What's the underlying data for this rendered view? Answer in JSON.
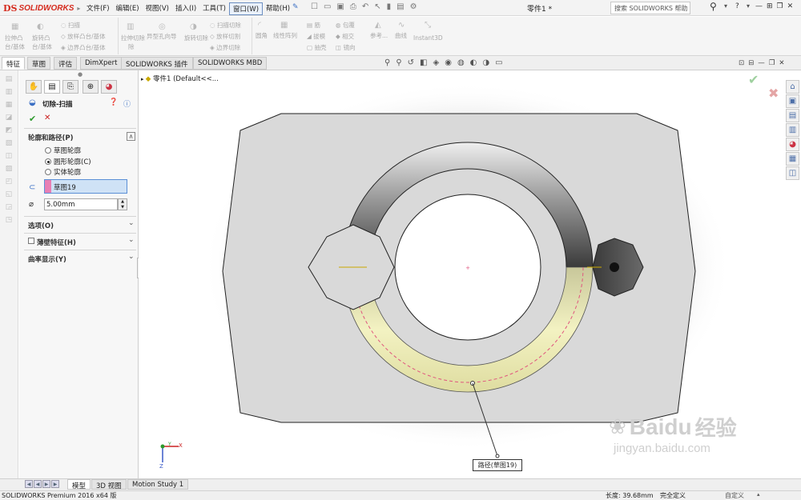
{
  "app": {
    "logo_mark": "DS",
    "logo_text": "SOLIDWORKS",
    "doc_title": "零件1 *"
  },
  "menu": [
    "文件(F)",
    "编辑(E)",
    "视图(V)",
    "插入(I)",
    "工具(T)",
    "窗口(W)",
    "帮助(H)"
  ],
  "search": {
    "placeholder": "搜索 SOLIDWORKS 帮助"
  },
  "help_label": "?",
  "ribbon": {
    "extrude_cut": "拉伸切除",
    "hole_wizard": "异型孔向导",
    "revolve_cut": "旋转切除",
    "sweep_cut": "扫描切除",
    "loft_cut": "放样切割",
    "boundary_cut": "边界切除",
    "fillet": "圆角",
    "linear_pattern": "线性阵列",
    "rib": "筋",
    "draft": "拔模",
    "shell": "抽壳",
    "wrap": "包覆",
    "intersect": "相交",
    "mirror": "镜向",
    "reference": "参考...",
    "curves": "曲线",
    "instant3d": "Instant3D",
    "boss_extrude_1": "拉伸凸",
    "boss_extrude_2": "台/基体",
    "revolve_boss_1": "旋转凸",
    "revolve_boss_2": "台/基体",
    "swept_boss": "扫描",
    "lofted_boss": "放样凸台/基体",
    "boundary_boss": "边界凸台/基体",
    "extrude_cut_2": "除"
  },
  "tabs": [
    "特征",
    "草图",
    "评估",
    "DimXpert",
    "SOLIDWORKS 插件",
    "SOLIDWORKS MBD"
  ],
  "tree": {
    "root": "零件1  (Default<<..."
  },
  "property_manager": {
    "title": "切除-扫描",
    "section_profile_path": "轮廓和路径(P)",
    "radio_sketch_profile": "草图轮廓",
    "radio_circular_profile": "圆形轮廓(C)",
    "radio_solid_profile": "实体轮廓",
    "path_value": "草图19",
    "diameter_value": "5.00mm",
    "section_options": "选项(O)",
    "section_thin": "薄壁特征(H)",
    "section_curvature": "曲率显示(Y)"
  },
  "callout": "路径(草图19)",
  "triad": {
    "x": "X",
    "y": "Y",
    "z": "Z"
  },
  "bottom_tabs": [
    "模型",
    "3D 视图",
    "Motion Study 1"
  ],
  "status": {
    "product": "SOLIDWORKS Premium 2016 x64 版",
    "length": "长度: 39.68mm",
    "state": "完全定义",
    "custom": "自定义"
  },
  "watermark": {
    "brand": "Baidu",
    "brand_cn": "经验",
    "url": "jingyan.baidu.com"
  },
  "colors": {
    "accent": "#d52b1e",
    "selection_pink": "#e87fb4",
    "sweep_yellow": "#eceba8",
    "field_blue": "#cfe2f6"
  }
}
